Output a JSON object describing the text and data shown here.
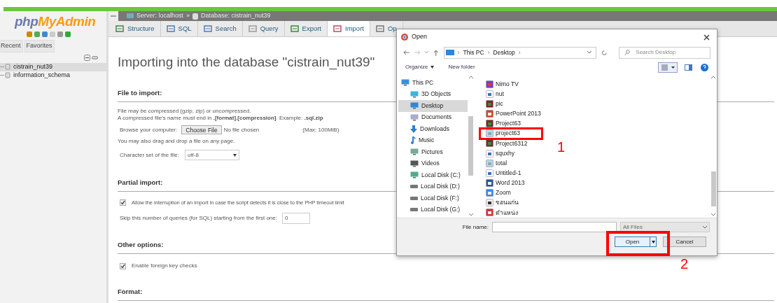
{
  "sidebar": {
    "logo": {
      "prefix": "php",
      "name": "MyAdmin"
    },
    "tabs": [
      {
        "label": "Recent",
        "selected": false
      },
      {
        "label": "Favorites",
        "selected": false
      }
    ],
    "databases": [
      {
        "name": "cistrain_nut39",
        "selected": true
      },
      {
        "name": "information_schema",
        "selected": false
      }
    ]
  },
  "breadcrumb": {
    "server": "Server: localhost",
    "separator": "»",
    "database": "Database: cistrain_nut39"
  },
  "tabs": [
    {
      "label": "Structure",
      "kind": "structure",
      "selected": false
    },
    {
      "label": "SQL",
      "kind": "sql",
      "selected": false
    },
    {
      "label": "Search",
      "kind": "search",
      "selected": false
    },
    {
      "label": "Query",
      "kind": "query",
      "selected": false
    },
    {
      "label": "Export",
      "kind": "export",
      "selected": false
    },
    {
      "label": "Import",
      "kind": "import",
      "selected": true
    },
    {
      "label": "Op",
      "kind": "operations",
      "selected": false
    }
  ],
  "page": {
    "title": "Importing into the database \"cistrain_nut39\"",
    "file_section": {
      "legend": "File to import:",
      "note_1": "File may be compressed (gzip, zip) or uncompressed.",
      "note_2": "A compressed file's name must end in **.[format].[compression]**. Example: **.sql.zip**",
      "browse_label": "Browse your computer:",
      "choose_button": "Choose File",
      "no_file": "No file chosen",
      "max": "(Max: 100MiB)",
      "drag_note": "You may also drag and drop a file on any page.",
      "charset_label": "Character set of the file:",
      "charset_value": "utf-8"
    },
    "partial_section": {
      "legend": "Partial import:",
      "allow_interrupt": {
        "label": "Allow the interruption of an import in case the script detects it is close to the PHP timeout limit",
        "checked": true
      },
      "skip_label": "Skip this number of queries (for SQL) starting from the first one:",
      "skip_value": "0"
    },
    "other_section": {
      "legend": "Other options:",
      "foreign_key": {
        "label": "Enable foreign key checks",
        "checked": true
      }
    },
    "format_section": {
      "legend": "Format:"
    }
  },
  "dialog": {
    "title": "Open",
    "path": [
      "This PC",
      "Desktop"
    ],
    "path_separator": "›",
    "search_placeholder": "Search Desktop",
    "organize": "Organize",
    "new_folder": "New folder",
    "nav": [
      {
        "label": "This PC",
        "kind": "pc",
        "selected": false,
        "children": [
          {
            "label": "3D Objects",
            "kind": "cube",
            "selected": false
          },
          {
            "label": "Desktop",
            "kind": "desktop",
            "selected": true
          },
          {
            "label": "Documents",
            "kind": "docs",
            "selected": false
          },
          {
            "label": "Downloads",
            "kind": "download",
            "selected": false
          },
          {
            "label": "Music",
            "kind": "music",
            "selected": false
          },
          {
            "label": "Pictures",
            "kind": "pictures",
            "selected": false
          },
          {
            "label": "Videos",
            "kind": "videos",
            "selected": false
          },
          {
            "label": "Local Disk (C:)",
            "kind": "system-disk",
            "selected": false
          },
          {
            "label": "Local Disk (D:)",
            "kind": "disk",
            "selected": false
          },
          {
            "label": "Local Disk (F:)",
            "kind": "disk",
            "selected": false
          },
          {
            "label": "Local Disk (G:)",
            "kind": "disk",
            "selected": false
          }
        ]
      }
    ],
    "files": [
      {
        "name": "Nimo TV",
        "kind": "app"
      },
      {
        "name": "nut",
        "kind": "image"
      },
      {
        "name": "pic",
        "kind": "archive"
      },
      {
        "name": "PowerPoint 2013",
        "kind": "powerpoint"
      },
      {
        "name": "Project63",
        "kind": "archive"
      },
      {
        "name": "project63",
        "kind": "sql"
      },
      {
        "name": "Project6312",
        "kind": "archive"
      },
      {
        "name": "squxhy",
        "kind": "image"
      },
      {
        "name": "total",
        "kind": "sql"
      },
      {
        "name": "Untitled-1",
        "kind": "image"
      },
      {
        "name": "Word 2013",
        "kind": "word"
      },
      {
        "name": "Zoom",
        "kind": "zoom"
      },
      {
        "name": "ขอนแก่น",
        "kind": "script"
      },
      {
        "name": "ตำแหน่ง",
        "kind": "pdf"
      }
    ],
    "file_name_label": "File name:",
    "filter": "All Files",
    "open_button": "Open",
    "cancel_button": "Cancel"
  },
  "annotations": [
    {
      "number": "1"
    },
    {
      "number": "2"
    }
  ]
}
